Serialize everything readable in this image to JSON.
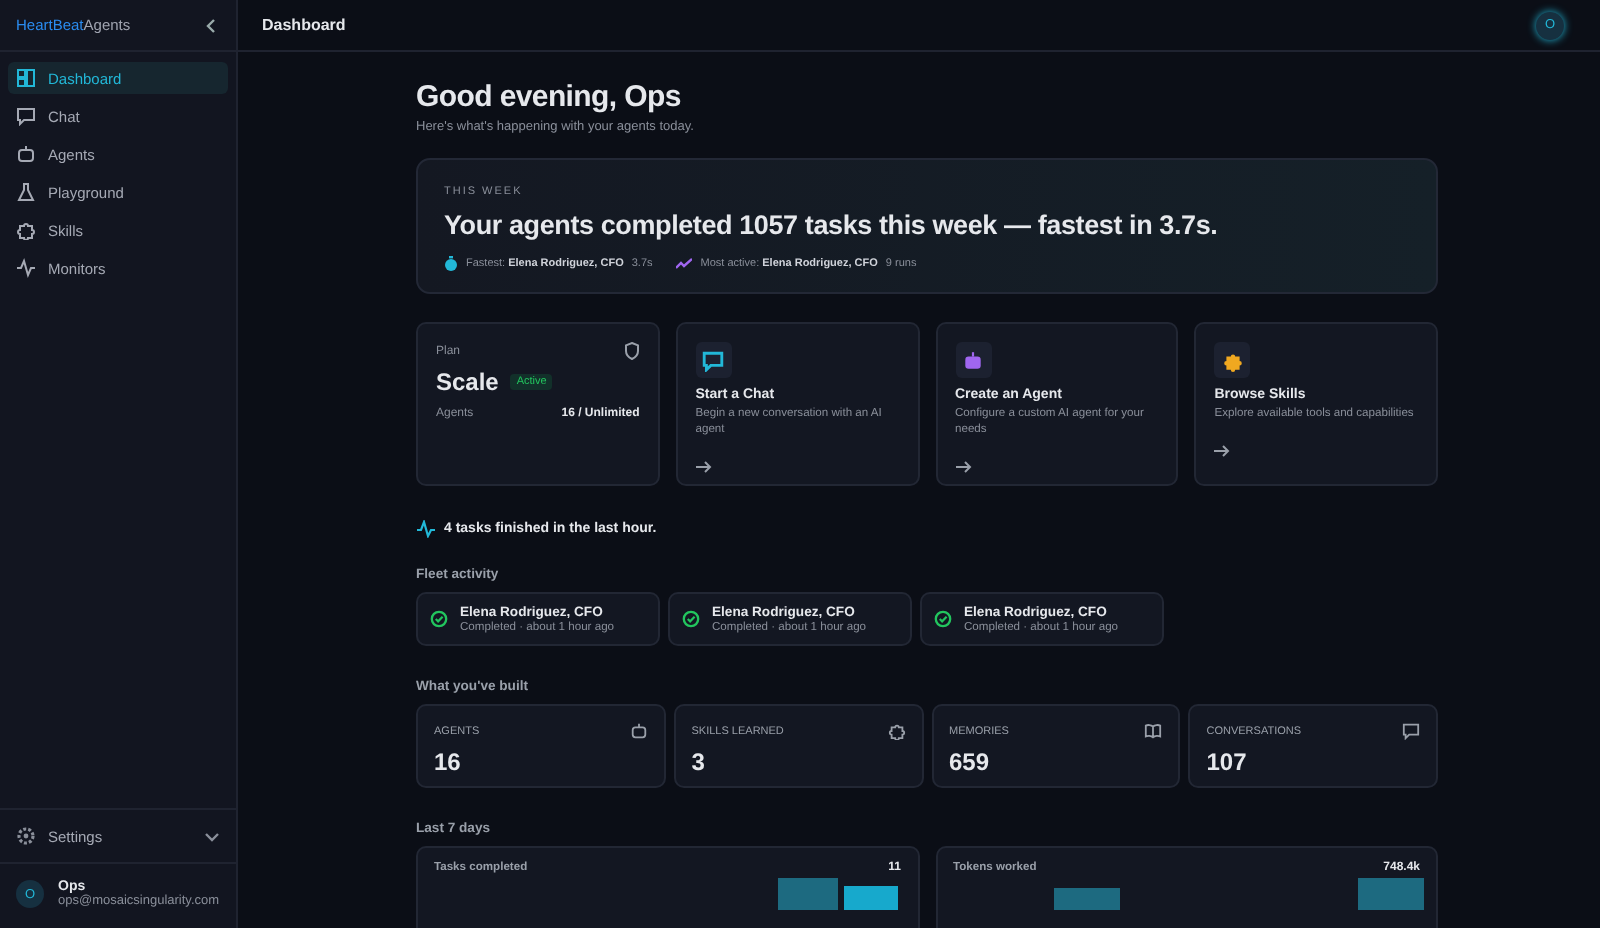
{
  "brand": {
    "part1": "HeartBeat",
    "part2": "Agents"
  },
  "sidebar": {
    "items": [
      {
        "label": "Dashboard",
        "kind": "grid",
        "selected": true
      },
      {
        "label": "Chat",
        "kind": "chat",
        "selected": false
      },
      {
        "label": "Agents",
        "kind": "bot",
        "selected": false
      },
      {
        "label": "Playground",
        "kind": "flask",
        "selected": false
      },
      {
        "label": "Skills",
        "kind": "puzzle",
        "selected": false
      },
      {
        "label": "Monitors",
        "kind": "pulse",
        "selected": false
      }
    ],
    "settings": "Settings",
    "user": {
      "initial": "O",
      "name": "Ops",
      "email": "ops@mosaicsingularity.com"
    }
  },
  "topbar": {
    "title": "Dashboard",
    "avatar": "O"
  },
  "greeting": "Good evening, Ops",
  "subtitle": "Here's what's happening with your agents today.",
  "hero": {
    "eyebrow": "THIS WEEK",
    "headline": "Your agents completed 1057 tasks this week — fastest in 3.7s.",
    "fastest": {
      "label": "Fastest:",
      "name": "Elena Rodriguez, CFO",
      "value": "3.7s"
    },
    "most_active": {
      "label": "Most active:",
      "name": "Elena Rodriguez, CFO",
      "value": "9 runs"
    }
  },
  "plan": {
    "label": "Plan",
    "name": "Scale",
    "status": "Active",
    "agents_label": "Agents",
    "agents_value": "16 / Unlimited"
  },
  "actions": [
    {
      "title": "Start a Chat",
      "description": "Begin a new conversation with an AI agent",
      "kind": "chat",
      "color": "#22b8d8"
    },
    {
      "title": "Create an Agent",
      "description": "Configure a custom AI agent for your needs",
      "kind": "bot",
      "color": "#a066f0"
    },
    {
      "title": "Browse Skills",
      "description": "Explore available tools and capabilities",
      "kind": "puzzle",
      "color": "#f0a820"
    }
  ],
  "tasks_note": "4 tasks finished in the last hour.",
  "fleet": {
    "title": "Fleet activity",
    "items": [
      {
        "name": "Elena Rodriguez, CFO",
        "status": "Completed · about 1 hour ago"
      },
      {
        "name": "Elena Rodriguez, CFO",
        "status": "Completed · about 1 hour ago"
      },
      {
        "name": "Elena Rodriguez, CFO",
        "status": "Completed · about 1 hour ago"
      }
    ]
  },
  "built": {
    "title": "What you've built",
    "stats": [
      {
        "label": "AGENTS",
        "value": "16",
        "kind": "bot"
      },
      {
        "label": "SKILLS LEARNED",
        "value": "3",
        "kind": "puzzle"
      },
      {
        "label": "MEMORIES",
        "value": "659",
        "kind": "book"
      },
      {
        "label": "CONVERSATIONS",
        "value": "107",
        "kind": "chat"
      }
    ]
  },
  "last7": {
    "title": "Last 7 days",
    "cards": [
      {
        "title": "Tasks completed",
        "total": "11"
      },
      {
        "title": "Tokens worked",
        "total": "748.4k"
      }
    ]
  }
}
